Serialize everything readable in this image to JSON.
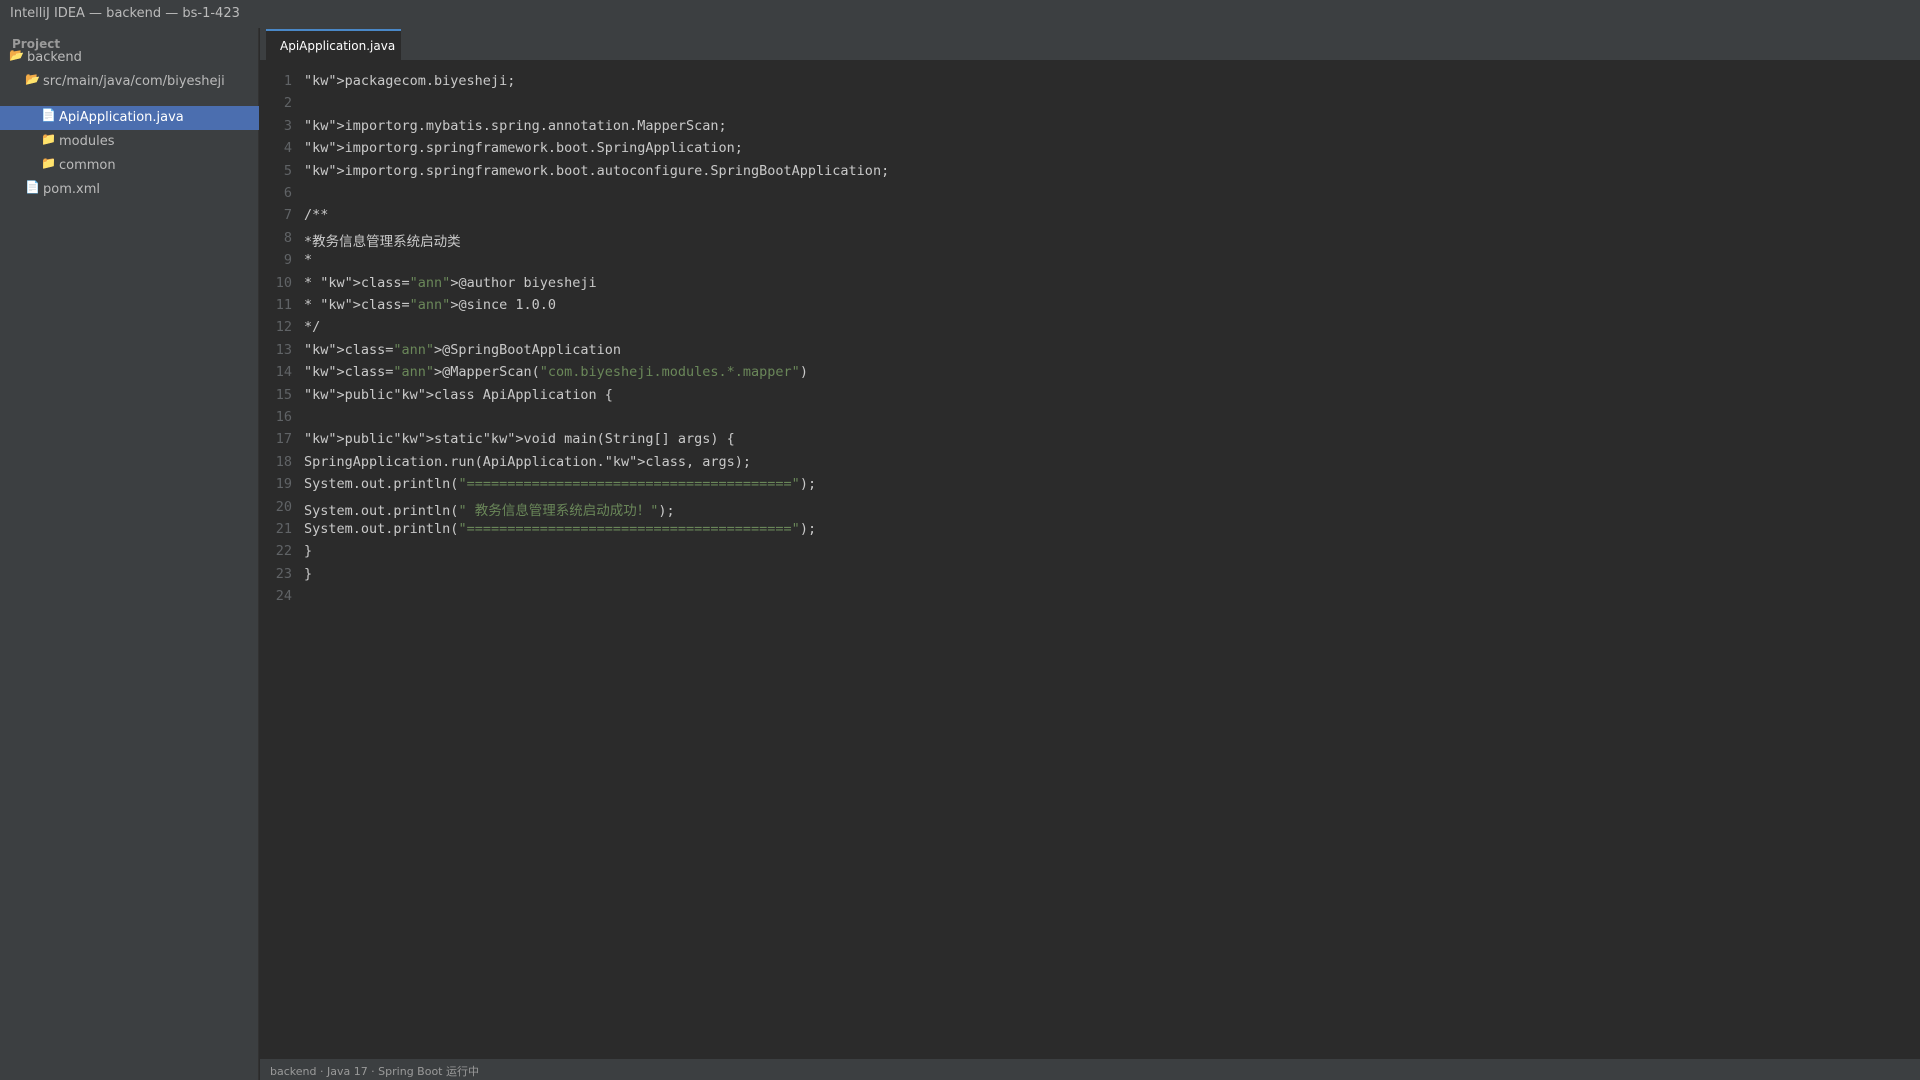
{
  "window": {
    "title": "IntelliJ IDEA — backend — bs-1-423"
  },
  "sidebar": {
    "header": "Project",
    "items": [
      {
        "label": "backend",
        "icon": "folder-open-icon",
        "glyph": "📂"
      },
      {
        "label": "src/main/java/com/biyesheji",
        "icon": "folder-open-icon",
        "glyph": "📂"
      },
      {
        "label": "ApiApplication.java",
        "icon": "file-icon",
        "glyph": "📄",
        "selected": true
      },
      {
        "label": "modules",
        "icon": "folder-icon",
        "glyph": "📁"
      },
      {
        "label": "common",
        "icon": "folder-icon",
        "glyph": "📁"
      },
      {
        "label": "pom.xml",
        "icon": "file-icon",
        "glyph": "📄"
      }
    ]
  },
  "editor": {
    "tab_label": "ApiApplication.java",
    "lines": [
      {
        "num": "1",
        "tokens": [
          {
            "t": "\"kw\">packagecom.biyesheji;",
            "c": "plain"
          }
        ]
      },
      {
        "num": "2",
        "tokens": []
      },
      {
        "num": "3",
        "tokens": [
          {
            "t": "\"kw\">importorg.mybatis.spring.annotation.MapperScan;",
            "c": "plain"
          }
        ]
      },
      {
        "num": "4",
        "tokens": [
          {
            "t": "\"kw\">importorg.springframework.boot.SpringApplication;",
            "c": "plain"
          }
        ]
      },
      {
        "num": "5",
        "tokens": [
          {
            "t": "\"kw\">importorg.springframework.boot.autoconfigure.SpringBootApplication;",
            "c": "plain"
          }
        ]
      },
      {
        "num": "6",
        "tokens": []
      },
      {
        "num": "7",
        "tokens": [
          {
            "t": "/**",
            "c": "plain"
          }
        ]
      },
      {
        "num": "8",
        "tokens": [
          {
            "t": "*教务信息管理系统启动类",
            "c": "plain"
          }
        ]
      },
      {
        "num": "9",
        "tokens": [
          {
            "t": "*",
            "c": "plain"
          }
        ]
      },
      {
        "num": "10",
        "tokens": [
          {
            "t": "* \"kw\">class=",
            "c": "plain"
          },
          {
            "t": "\"ann\"",
            "c": "ann"
          },
          {
            "t": ">@author biyesheji",
            "c": "plain"
          }
        ]
      },
      {
        "num": "11",
        "tokens": [
          {
            "t": "* \"kw\">class=",
            "c": "plain"
          },
          {
            "t": "\"ann\"",
            "c": "ann"
          },
          {
            "t": ">@since 1.0.0",
            "c": "plain"
          }
        ]
      },
      {
        "num": "12",
        "tokens": [
          {
            "t": "*/",
            "c": "plain"
          }
        ]
      },
      {
        "num": "13",
        "tokens": [
          {
            "t": "\"kw\">class=",
            "c": "plain"
          },
          {
            "t": "\"ann\"",
            "c": "ann"
          },
          {
            "t": ">@SpringBootApplication",
            "c": "plain"
          }
        ]
      },
      {
        "num": "14",
        "tokens": [
          {
            "t": "\"kw\">class=",
            "c": "plain"
          },
          {
            "t": "\"ann\"",
            "c": "ann"
          },
          {
            "t": ">@MapperScan(",
            "c": "plain"
          },
          {
            "t": "\"com.biyesheji.modules.*.mapper\"",
            "c": "str"
          },
          {
            "t": ")",
            "c": "plain"
          }
        ]
      },
      {
        "num": "15",
        "tokens": [
          {
            "t": "\"kw\">public\"kw\">class ApiApplication {",
            "c": "plain"
          }
        ]
      },
      {
        "num": "16",
        "tokens": []
      },
      {
        "num": "17",
        "tokens": [
          {
            "t": "\"kw\">public\"kw\">static\"kw\">void main(String[] args) {",
            "c": "plain"
          }
        ]
      },
      {
        "num": "18",
        "tokens": [
          {
            "t": "SpringApplication.run(ApiApplication.\"kw\">class, args);",
            "c": "plain"
          }
        ]
      },
      {
        "num": "19",
        "tokens": [
          {
            "t": "System.out.println(",
            "c": "plain"
          },
          {
            "t": "\"========================================\"",
            "c": "str"
          },
          {
            "t": ");",
            "c": "plain"
          }
        ]
      },
      {
        "num": "20",
        "tokens": [
          {
            "t": "System.out.println(",
            "c": "plain"
          },
          {
            "t": "\" 教务信息管理系统启动成功！\"",
            "c": "str"
          },
          {
            "t": ");",
            "c": "plain"
          }
        ]
      },
      {
        "num": "21",
        "tokens": [
          {
            "t": "System.out.println(",
            "c": "plain"
          },
          {
            "t": "\"========================================\"",
            "c": "str"
          },
          {
            "t": ");",
            "c": "plain"
          }
        ]
      },
      {
        "num": "22",
        "tokens": [
          {
            "t": "}",
            "c": "plain"
          }
        ]
      },
      {
        "num": "23",
        "tokens": [
          {
            "t": "}",
            "c": "plain"
          }
        ]
      },
      {
        "num": "24",
        "tokens": []
      }
    ]
  },
  "statusbar": {
    "text": "backend · Java 17 · Spring Boot 运行中"
  },
  "colors": {
    "accent": "#4b6eaf",
    "string": "#6a8759",
    "background": "#2b2b2b",
    "panel": "#3c3f41"
  }
}
